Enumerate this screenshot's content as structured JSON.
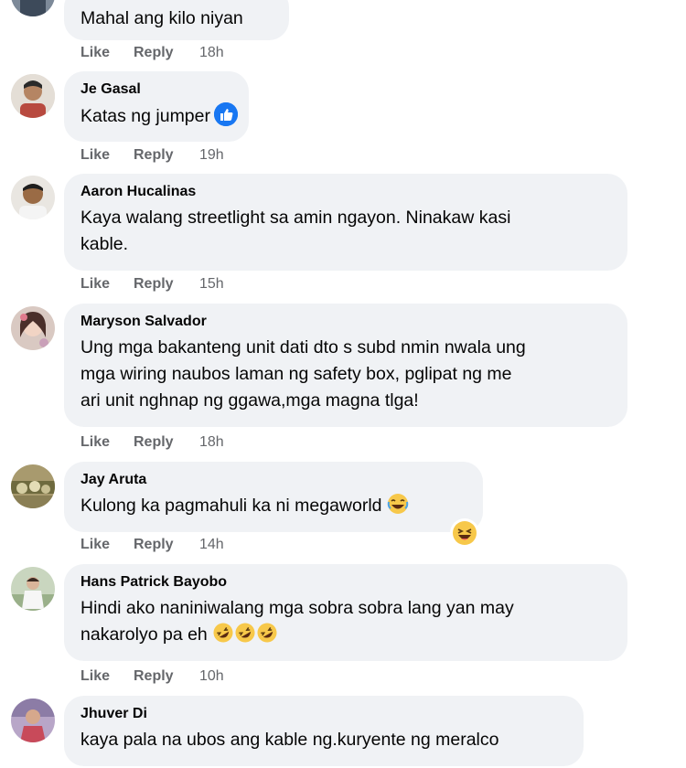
{
  "comments": [
    {
      "name": "",
      "lines": [
        "Mahal ang kilo niyan"
      ],
      "like": "Like",
      "reply": "Reply",
      "time": "18h"
    },
    {
      "name": "Je Gasal",
      "lines": [
        "Katas ng jumper"
      ],
      "like": "Like",
      "reply": "Reply",
      "time": "19h"
    },
    {
      "name": "Aaron Hucalinas",
      "lines": [
        "Kaya walang streetlight sa amin ngayon. Ninakaw kasi",
        "kable."
      ],
      "like": "Like",
      "reply": "Reply",
      "time": "15h"
    },
    {
      "name": "Maryson Salvador",
      "lines": [
        "Ung mga bakanteng unit dati dto s subd nmin nwala ung",
        "mga wiring naubos laman ng safety box, pglipat ng me",
        "ari unit nghnap ng ggawa,mga magna tlga!"
      ],
      "like": "Like",
      "reply": "Reply",
      "time": "18h"
    },
    {
      "name": "Jay Aruta",
      "lines": [
        "Kulong ka pagmahuli ka ni megaworld"
      ],
      "like": "Like",
      "reply": "Reply",
      "time": "14h"
    },
    {
      "name": "Hans Patrick Bayobo",
      "lines": [
        "Hindi ako naniniwalang mga sobra sobra lang yan may",
        "nakarolyo pa eh"
      ],
      "like": "Like",
      "reply": "Reply",
      "time": "10h"
    },
    {
      "name": "Jhuver Di",
      "lines": [
        "kaya pala na ubos ang kable ng.kuryente ng meralco"
      ],
      "like": "",
      "reply": "",
      "time": ""
    }
  ],
  "icons": {
    "like_reaction": "thumbs-up-icon",
    "laugh_reaction": "laughing-emoji-icon",
    "rofl_emoji": "rolling-laughing-emoji-icon"
  },
  "colors": {
    "bubble": "#f0f2f5",
    "action_text": "#65676b",
    "like_blue": "#1877f2"
  }
}
